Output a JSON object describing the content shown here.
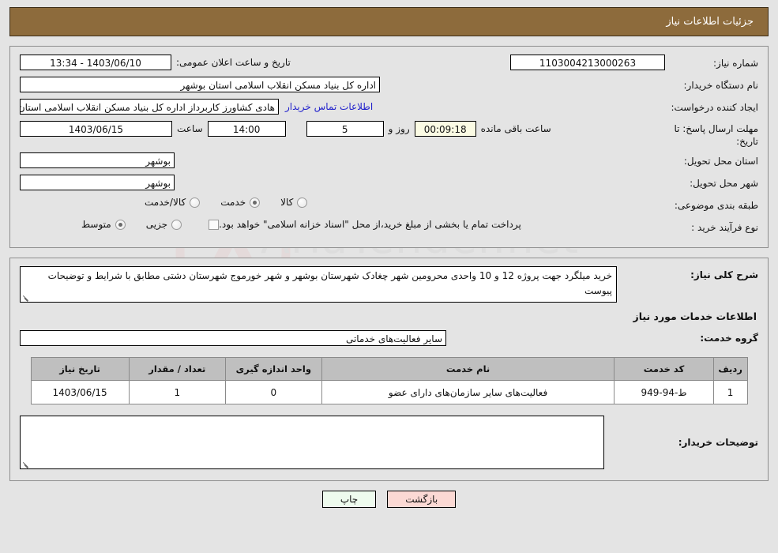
{
  "header": {
    "title": "جزئیات اطلاعات نیاز"
  },
  "info": {
    "need_number_label": "شماره نیاز:",
    "need_number_value": "1103004213000263",
    "public_announce_label": "تاریخ و ساعت اعلان عمومی:",
    "public_announce_value": "1403/06/10 - 13:34",
    "buyer_org_label": "نام دستگاه خریدار:",
    "buyer_org_value": "اداره کل بنیاد مسکن انقلاب اسلامی استان بوشهر",
    "requester_label": "ایجاد کننده درخواست:",
    "requester_value": "هادی کشاورز کاربرداز اداره کل بنیاد مسکن انقلاب اسلامی استان بوشهر",
    "contact_link": "اطلاعات تماس خریدار",
    "deadline_label": "مهلت ارسال پاسخ: تا تاریخ:",
    "deadline_date": "1403/06/15",
    "hour_word": "ساعت",
    "deadline_hour": "14:00",
    "remaining_days": "5",
    "days_and_word": "روز و",
    "remaining_timer": "00:09:18",
    "remaining_suffix": "ساعت باقی مانده",
    "province_label": "استان محل تحویل:",
    "province_value": "بوشهر",
    "city_label": "شهر محل تحویل:",
    "city_value": "بوشهر",
    "category_label": "طبقه بندی موضوعی:",
    "category_options": [
      {
        "label": "کالا",
        "selected": false
      },
      {
        "label": "خدمت",
        "selected": true
      },
      {
        "label": "کالا/خدمت",
        "selected": false
      }
    ],
    "purchase_type_label": "نوع فرآیند خرید :",
    "purchase_type_options": [
      {
        "label": "جزیی",
        "selected": false
      },
      {
        "label": "متوسط",
        "selected": true
      }
    ],
    "treasury_checkbox_checked": false,
    "treasury_note": "پرداخت تمام یا بخشی از مبلغ خرید،از محل \"اسناد خزانه اسلامی\" خواهد بود."
  },
  "description": {
    "need_summary_label": "شرح کلی نیاز:",
    "need_summary_value": "خرید میلگرد جهت پروژه 12 و 10 واحدی محرومین شهر چغادک شهرستان بوشهر و شهر خورموج شهرستان دشتی مطابق با شرایط و توضیحات پیوست",
    "services_section_title": "اطلاعات خدمات مورد نیاز",
    "service_group_label": "گروه خدمت:",
    "service_group_value": "سایر فعالیت‌های خدماتی"
  },
  "table": {
    "columns": [
      "ردیف",
      "کد خدمت",
      "نام خدمت",
      "واحد اندازه گیری",
      "تعداد / مقدار",
      "تاریخ نیاز"
    ],
    "rows": [
      {
        "radif": "1",
        "code": "ط-94-949",
        "name": "فعالیت‌های سایر سازمان‌های دارای عضو",
        "unit": "0",
        "qty": "1",
        "date": "1403/06/15"
      }
    ]
  },
  "buyer_notes": {
    "label": "توضیحات خریدار:",
    "value": "",
    "placeholder": ""
  },
  "footer": {
    "print_label": "چاپ",
    "back_label": "بازگشت"
  },
  "watermark": {
    "text": "AriaTender.net"
  },
  "colors": {
    "header_bar": "#8d6b3c",
    "page_bg": "#e4e4e4",
    "link": "#2222cc",
    "table_header": "#bfbfbf",
    "print_button": "#eefbee",
    "back_button": "#fbd9d4",
    "timer_field": "#fbfbe4"
  }
}
